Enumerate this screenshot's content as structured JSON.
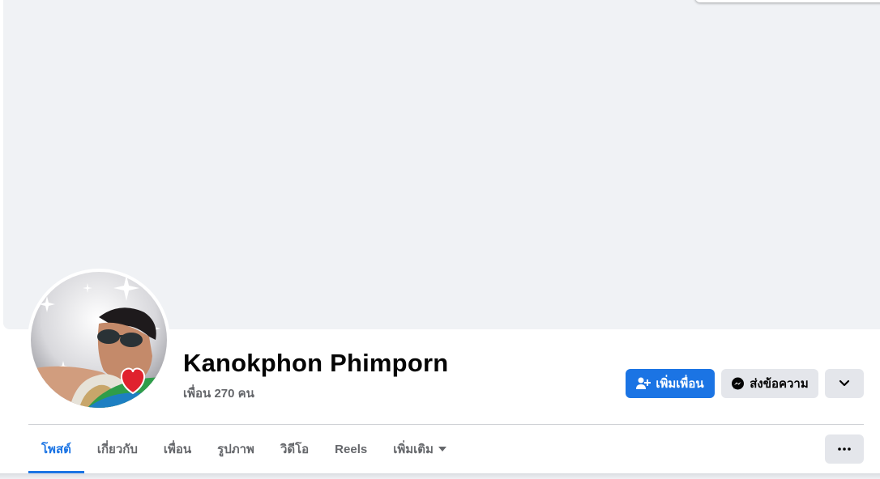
{
  "profile": {
    "name": "Kanokphon Phimporn",
    "friends_text": "เพื่อน 270 คน"
  },
  "actions": {
    "add_friend_label": "เพิ่มเพื่อน",
    "message_label": "ส่งข้อความ"
  },
  "tabs": [
    {
      "label": "โพสต์",
      "active": true
    },
    {
      "label": "เกี่ยวกับ",
      "active": false
    },
    {
      "label": "เพื่อน",
      "active": false
    },
    {
      "label": "รูปภาพ",
      "active": false
    },
    {
      "label": "วิดีโอ",
      "active": false
    },
    {
      "label": "Reels",
      "active": false
    },
    {
      "label": "เพิ่มเติม",
      "active": false
    }
  ],
  "icons": {
    "add_friend": "person-plus-icon",
    "message": "messenger-icon",
    "dropdown": "chevron-down-icon",
    "more_tab": "caret-down-icon",
    "more_options": "ellipsis-icon"
  },
  "colors": {
    "accent": "#1b74e4",
    "cover_bg": "#f0f2f5",
    "secondary_button": "#e4e6eb",
    "name_text": "#050505",
    "muted_text": "#65676b"
  }
}
